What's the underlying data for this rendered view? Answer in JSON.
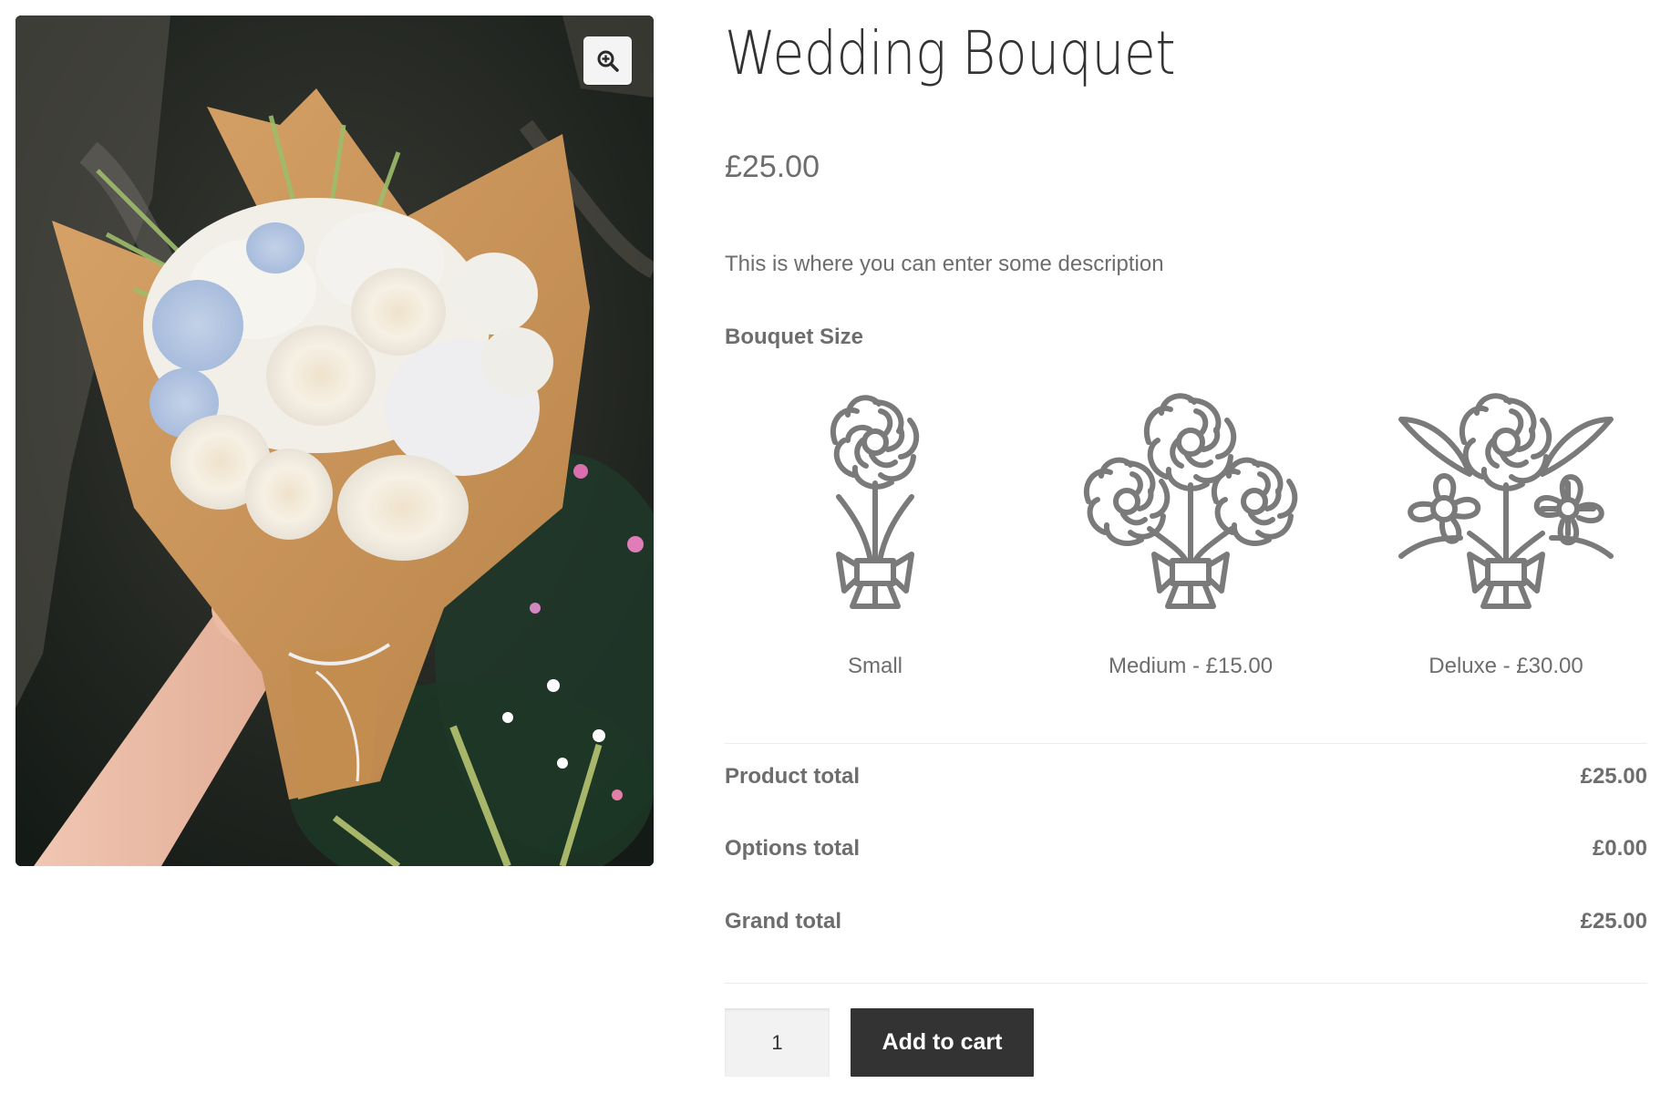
{
  "product": {
    "title": "Wedding Bouquet",
    "price": "£25.00",
    "description": "This is where you can enter some description",
    "image_alt": "Hand holding a wrapped bouquet of white roses, blue hydrangea and greenery",
    "zoom_icon": "magnifier-plus-icon"
  },
  "options": {
    "label": "Bouquet Size",
    "items": [
      {
        "label": "Small",
        "icon": "single-flower-bouquet-icon"
      },
      {
        "label": "Medium - £15.00",
        "icon": "three-flower-bouquet-icon"
      },
      {
        "label": "Deluxe - £30.00",
        "icon": "deluxe-bouquet-with-leaves-icon"
      }
    ]
  },
  "totals": [
    {
      "label": "Product total",
      "value": "£25.00"
    },
    {
      "label": "Options total",
      "value": "£0.00"
    },
    {
      "label": "Grand total",
      "value": "£25.00"
    }
  ],
  "cart": {
    "quantity": "1",
    "add_to_cart_label": "Add to cart"
  },
  "colors": {
    "button": "#333333",
    "text": "#6d6d6d",
    "title": "#333333",
    "icon_stroke": "#7a7a7a"
  }
}
